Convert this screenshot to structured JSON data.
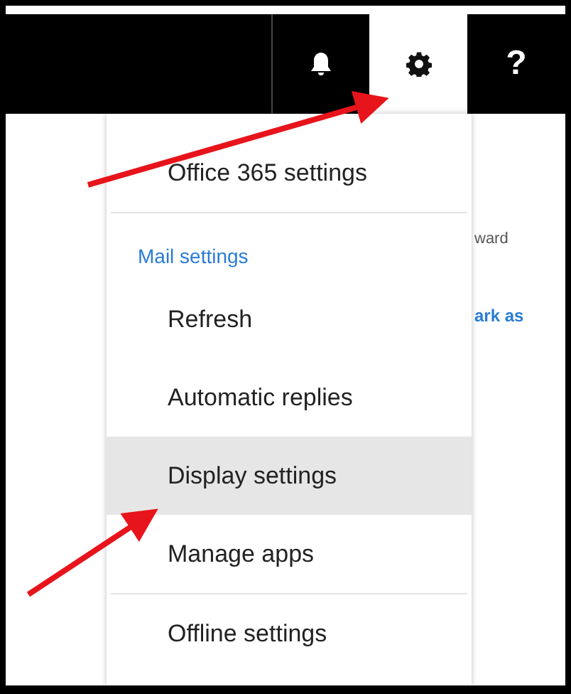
{
  "header": {
    "buttons": [
      {
        "kind": "bell",
        "selected": false
      },
      {
        "kind": "gear",
        "selected": true
      },
      {
        "kind": "help",
        "label": "?",
        "selected": false
      }
    ]
  },
  "menu": {
    "items": [
      {
        "kind": "item",
        "label": "Office 365 settings",
        "selected": false
      },
      {
        "kind": "divider"
      },
      {
        "kind": "heading",
        "label": "Mail settings"
      },
      {
        "kind": "item",
        "label": "Refresh",
        "selected": false
      },
      {
        "kind": "item",
        "label": "Automatic replies",
        "selected": false
      },
      {
        "kind": "item",
        "label": "Display settings",
        "selected": true
      },
      {
        "kind": "item",
        "label": "Manage apps",
        "selected": false
      },
      {
        "kind": "divider"
      },
      {
        "kind": "item",
        "label": "Offline settings",
        "selected": false
      }
    ]
  },
  "background": {
    "texts": [
      {
        "kind": "plain",
        "text": "ward"
      },
      {
        "kind": "link",
        "text": "ark as"
      }
    ]
  }
}
